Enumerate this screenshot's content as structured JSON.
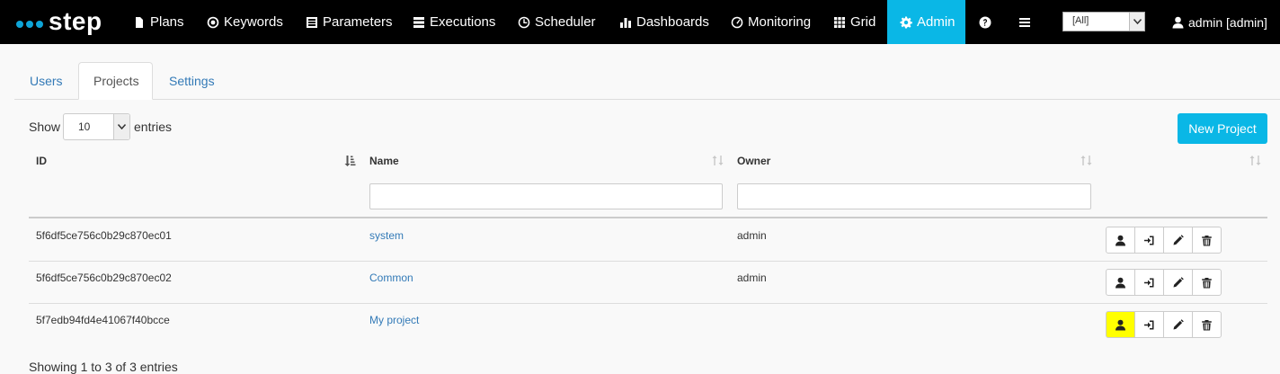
{
  "navbar": {
    "logo_text": "step",
    "items": [
      {
        "label": "Plans",
        "icon": "file-icon"
      },
      {
        "label": "Keywords",
        "icon": "record-icon"
      },
      {
        "label": "Parameters",
        "icon": "list-icon"
      },
      {
        "label": "Executions",
        "icon": "tasks-icon"
      },
      {
        "label": "Scheduler",
        "icon": "clock-icon"
      },
      {
        "label": "Dashboards",
        "icon": "stats-icon"
      },
      {
        "label": "Monitoring",
        "icon": "dashboard-icon"
      },
      {
        "label": "Grid",
        "icon": "grid-icon"
      },
      {
        "label": "Admin",
        "icon": "gear-icon",
        "active": true
      }
    ],
    "project_select": "[All]",
    "user_label": "admin [admin]"
  },
  "tabs": [
    {
      "label": "Users"
    },
    {
      "label": "Projects",
      "active": true
    },
    {
      "label": "Settings"
    }
  ],
  "table_controls": {
    "show_label": "Show",
    "page_length": "10",
    "entries_label": "entries",
    "new_button": "New Project"
  },
  "table": {
    "columns": [
      "ID",
      "Name",
      "Owner",
      ""
    ],
    "rows": [
      {
        "id": "5f6df5ce756c0b29c870ec01",
        "name": "system",
        "owner": "admin"
      },
      {
        "id": "5f6df5ce756c0b29c870ec02",
        "name": "Common",
        "owner": "admin"
      },
      {
        "id": "5f7edb94fd4e41067f40bcce",
        "name": "My project",
        "owner": ""
      }
    ],
    "row_actions": [
      "user-icon",
      "log-in-icon",
      "pencil-icon",
      "trash-icon"
    ],
    "info": "Showing 1 to 3 of 3 entries"
  },
  "colors": {
    "navbar": "#000000",
    "accent": "#0ab7e6",
    "link": "#337ab7",
    "highlight": "#ffff00"
  }
}
